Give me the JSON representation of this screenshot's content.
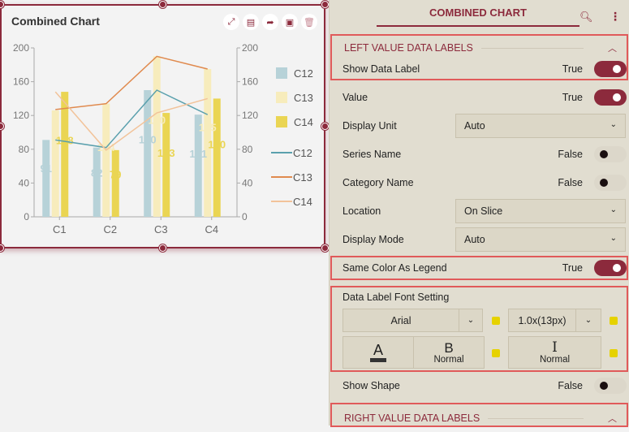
{
  "widget": {
    "title": "Combined Chart",
    "icons": [
      "expand-icon",
      "comment-icon",
      "share-icon",
      "save-data-icon",
      "delete-icon"
    ]
  },
  "chart_data": {
    "type": "bar",
    "title": "Combined Chart",
    "categories": [
      "C1",
      "C2",
      "C3",
      "C4"
    ],
    "left_axis": {
      "ticks": [
        "0",
        "40",
        "80",
        "120",
        "160",
        "200"
      ],
      "ylim": [
        0,
        200
      ]
    },
    "right_axis": {
      "ticks": [
        "0",
        "40",
        "80",
        "120",
        "160",
        "200"
      ],
      "ylim": [
        0,
        200
      ]
    },
    "bar_series": [
      {
        "name": "C12",
        "color": "#b7d2d8",
        "values": [
          91,
          82,
          150,
          121
        ]
      },
      {
        "name": "C13",
        "color": "#f7ecbc",
        "values": [
          126,
          134,
          190,
          175
        ]
      },
      {
        "name": "C14",
        "color": "#ead553",
        "values": [
          148,
          79,
          123,
          140
        ]
      }
    ],
    "line_series": [
      {
        "name": "C12",
        "color": "#5aa0ad",
        "values": [
          91,
          82,
          150,
          121
        ]
      },
      {
        "name": "C13",
        "color": "#e08a4e",
        "values": [
          127,
          134,
          190,
          175
        ]
      },
      {
        "name": "C14",
        "color": "#f2c39a",
        "values": [
          148,
          79,
          123,
          140
        ]
      }
    ],
    "data_labels": {
      "C12": [
        "91",
        "82",
        "150",
        "121"
      ],
      "C14": [
        "148",
        "79",
        "123",
        "140"
      ],
      "C13_partial": [
        "",
        "134",
        "190",
        "175"
      ]
    },
    "legend": {
      "placement": "right",
      "bars": [
        "C12",
        "C13",
        "C14"
      ],
      "lines": [
        "C12",
        "C13",
        "C14"
      ]
    }
  },
  "panel": {
    "title": "COMBINED CHART",
    "search_icon": "search-icon",
    "menu_icon": "more-vertical-icon",
    "left_section": "LEFT VALUE DATA LABELS",
    "right_section": "RIGHT VALUE DATA LABELS",
    "rows": {
      "show_data_label": {
        "label": "Show Data Label",
        "value": "True"
      },
      "value": {
        "label": "Value",
        "value": "True"
      },
      "display_unit": {
        "label": "Display Unit",
        "selected": "Auto"
      },
      "series_name": {
        "label": "Series Name",
        "value": "False"
      },
      "category_name": {
        "label": "Category Name",
        "value": "False"
      },
      "location": {
        "label": "Location",
        "selected": "On Slice"
      },
      "display_mode": {
        "label": "Display Mode",
        "selected": "Auto"
      },
      "same_color": {
        "label": "Same Color As Legend",
        "value": "True"
      },
      "show_shape": {
        "label": "Show Shape",
        "value": "False"
      }
    },
    "font_setting": {
      "label": "Data Label Font Setting",
      "font_family": "Arial",
      "font_size": "1.0x(13px)",
      "color_glyph": "A",
      "bold_glyph": "B",
      "bold_value": "Normal",
      "italic_glyph": "I",
      "italic_value": "Normal"
    }
  }
}
